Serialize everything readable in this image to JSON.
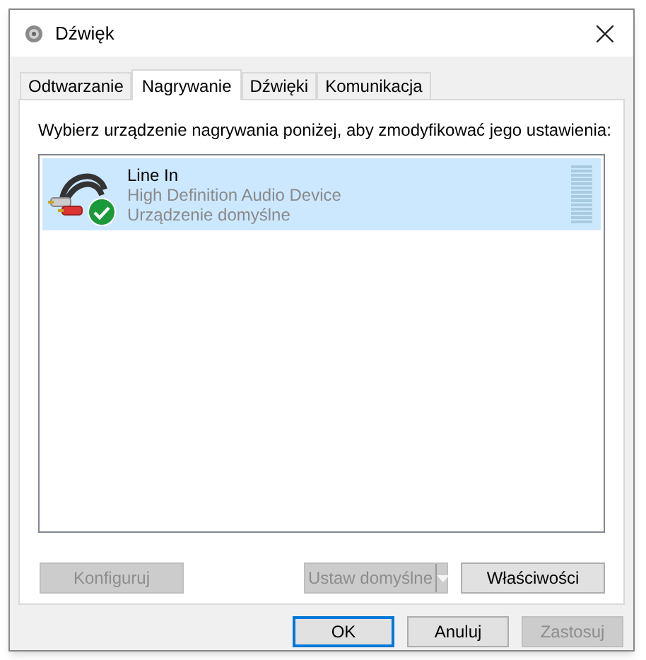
{
  "window": {
    "title": "Dźwięk"
  },
  "tabs": [
    {
      "label": "Odtwarzanie",
      "selected": false
    },
    {
      "label": "Nagrywanie",
      "selected": true
    },
    {
      "label": "Dźwięki",
      "selected": false
    },
    {
      "label": "Komunikacja",
      "selected": false
    }
  ],
  "instruction": "Wybierz urządzenie nagrywania poniżej, aby zmodyfikować jego ustawienia:",
  "devices": [
    {
      "name": "Line In",
      "description": "High Definition Audio Device",
      "status": "Urządzenie domyślne",
      "default": true,
      "selected": true
    }
  ],
  "panel_buttons": [
    {
      "kind": "button",
      "label": "Konfiguruj",
      "disabled": true
    },
    {
      "kind": "split",
      "label": "Ustaw domyślne",
      "disabled": true
    },
    {
      "kind": "button",
      "label": "Właściwości",
      "disabled": false
    }
  ],
  "dialog_buttons": [
    {
      "label": "OK",
      "disabled": false,
      "default": true
    },
    {
      "label": "Anuluj",
      "disabled": false,
      "default": false
    },
    {
      "label": "Zastosuj",
      "disabled": true,
      "default": false
    }
  ]
}
